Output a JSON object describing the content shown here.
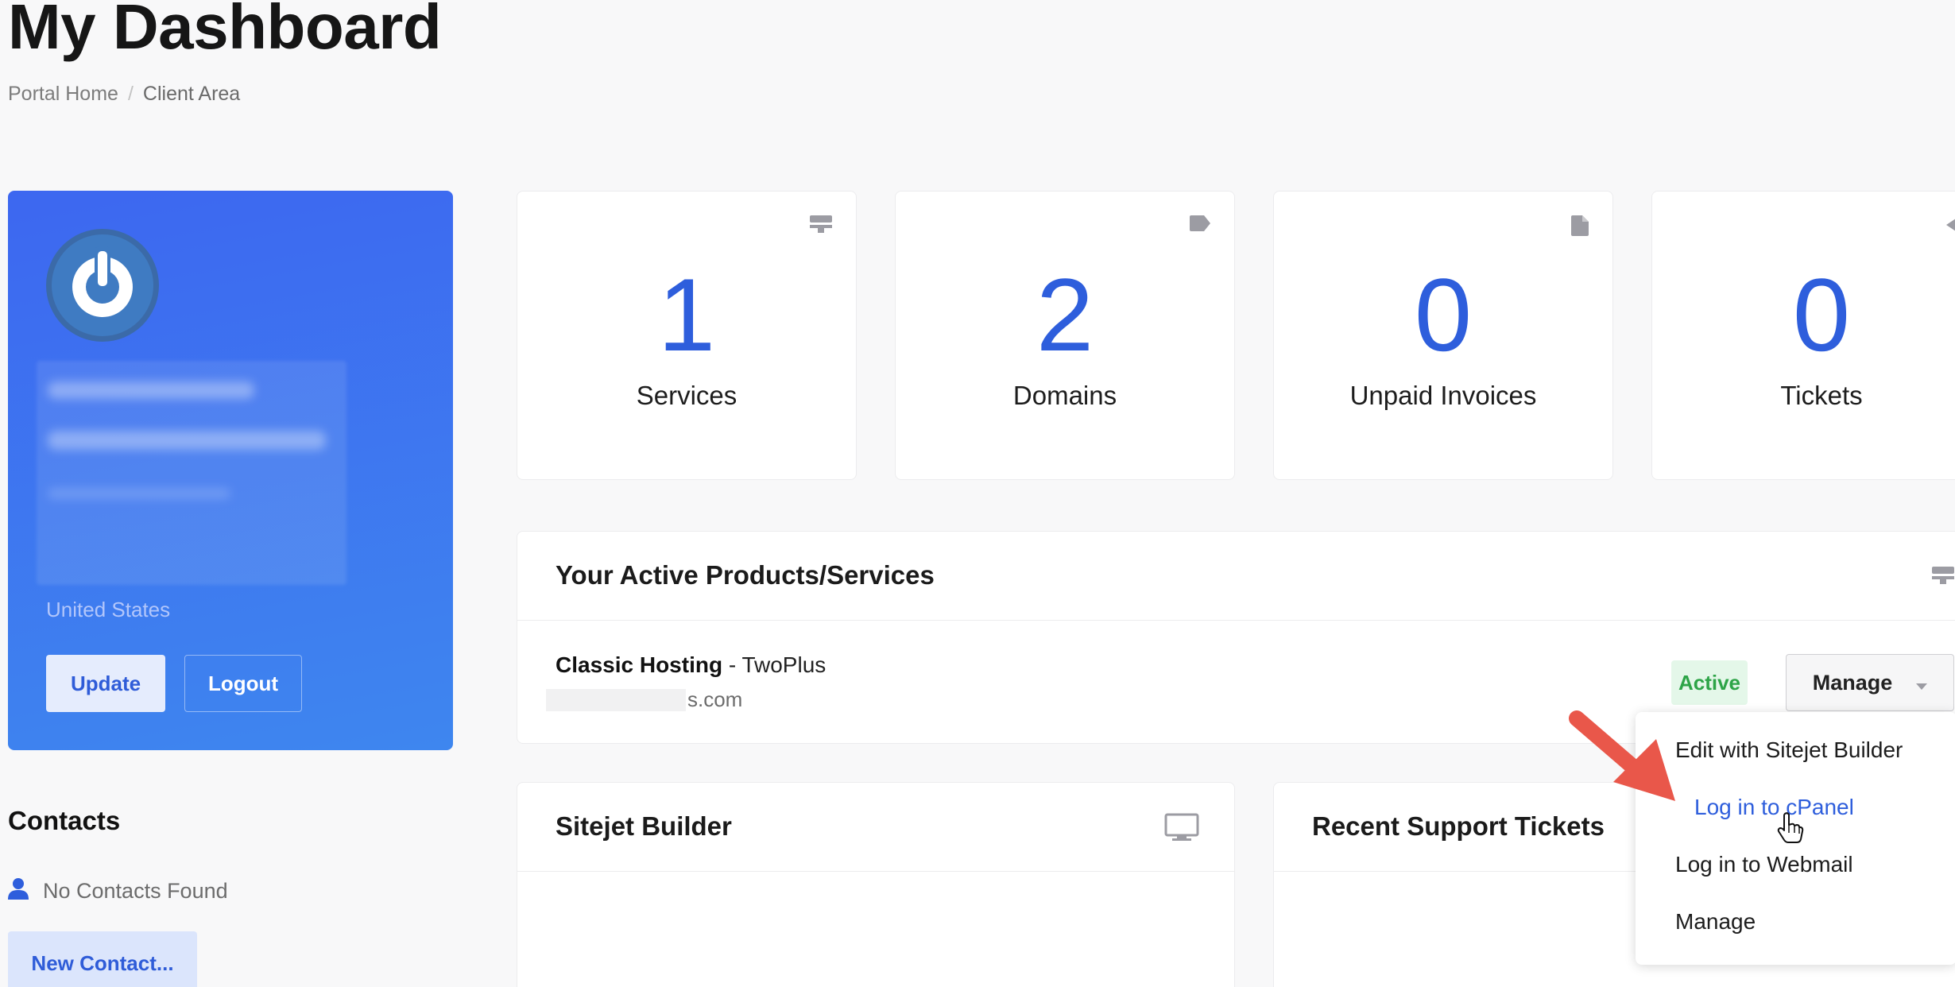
{
  "header": {
    "title": "My Dashboard",
    "breadcrumb": {
      "home": "Portal Home",
      "separator": "/",
      "current": "Client Area"
    }
  },
  "profile": {
    "country": "United States",
    "update_label": "Update",
    "logout_label": "Logout"
  },
  "contacts": {
    "title": "Contacts",
    "empty_text": "No Contacts Found",
    "new_contact_label": "New Contact..."
  },
  "stats": [
    {
      "count": "1",
      "label": "Services",
      "icon": "server-icon"
    },
    {
      "count": "2",
      "label": "Domains",
      "icon": "tag-icon"
    },
    {
      "count": "0",
      "label": "Unpaid Invoices",
      "icon": "document-icon"
    },
    {
      "count": "0",
      "label": "Tickets",
      "icon": "comment-icon"
    }
  ],
  "products": {
    "title": "Your Active Products/Services",
    "item": {
      "product": "Classic Hosting",
      "separator": " - ",
      "plan": "TwoPlus",
      "domain_suffix": "s.com",
      "status": "Active",
      "manage_label": "Manage"
    }
  },
  "manage_menu": {
    "items": [
      "Edit with Sitejet Builder",
      "Log in to cPanel",
      "Log in to Webmail",
      "Manage"
    ]
  },
  "sitejet": {
    "title": "Sitejet Builder"
  },
  "tickets": {
    "title": "Recent Support Tickets"
  },
  "colors": {
    "accent": "#2e5edc",
    "card_gradient_start": "#3d67f0",
    "card_gradient_end": "#3e86ef",
    "active_green": "#2da447",
    "arrow_red": "#e9574a"
  }
}
